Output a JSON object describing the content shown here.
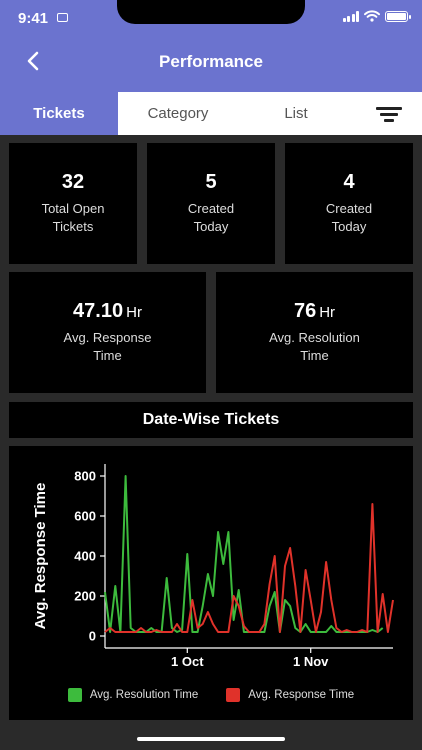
{
  "status_bar": {
    "time": "9:41"
  },
  "header": {
    "title": "Performance"
  },
  "tabs": [
    {
      "label": "Tickets",
      "active": true
    },
    {
      "label": "Category",
      "active": false
    },
    {
      "label": "List",
      "active": false
    }
  ],
  "stats_row1": [
    {
      "value": "32",
      "label_line1": "Total Open",
      "label_line2": "Tickets"
    },
    {
      "value": "5",
      "label_line1": "Created",
      "label_line2": "Today"
    },
    {
      "value": "4",
      "label_line1": "Created",
      "label_line2": "Today"
    }
  ],
  "stats_row2": [
    {
      "value": "47.10",
      "unit": "Hr",
      "label_line1": "Avg. Response",
      "label_line2": "Time"
    },
    {
      "value": "76",
      "unit": "Hr",
      "label_line1": "Avg. Resolution",
      "label_line2": "Time"
    }
  ],
  "section": {
    "title": "Date-Wise Tickets"
  },
  "colors": {
    "accent": "#6b73cf",
    "green": "#3dbb3d",
    "red": "#e0322a"
  },
  "chart_data": {
    "type": "line",
    "ylabel": "Avg. Response Time",
    "xlabel": "",
    "ylim": [
      -60,
      860
    ],
    "yticks": [
      0,
      200,
      400,
      600,
      800
    ],
    "xlim": [
      0,
      56
    ],
    "xticks": [
      {
        "x": 16,
        "label": "1 Oct"
      },
      {
        "x": 40,
        "label": "1 Nov"
      }
    ],
    "series": [
      {
        "name": "Avg. Resolution Time",
        "color": "#3dbb3d",
        "points": [
          [
            0,
            220
          ],
          [
            1,
            20
          ],
          [
            2,
            250
          ],
          [
            3,
            20
          ],
          [
            4,
            800
          ],
          [
            5,
            40
          ],
          [
            6,
            20
          ],
          [
            7,
            20
          ],
          [
            8,
            20
          ],
          [
            9,
            40
          ],
          [
            10,
            20
          ],
          [
            11,
            20
          ],
          [
            12,
            290
          ],
          [
            13,
            40
          ],
          [
            14,
            20
          ],
          [
            15,
            30
          ],
          [
            16,
            410
          ],
          [
            17,
            20
          ],
          [
            18,
            20
          ],
          [
            19,
            150
          ],
          [
            20,
            310
          ],
          [
            21,
            200
          ],
          [
            22,
            520
          ],
          [
            23,
            360
          ],
          [
            24,
            520
          ],
          [
            25,
            80
          ],
          [
            26,
            230
          ],
          [
            27,
            20
          ],
          [
            28,
            20
          ],
          [
            29,
            20
          ],
          [
            30,
            20
          ],
          [
            31,
            20
          ],
          [
            32,
            150
          ],
          [
            33,
            220
          ],
          [
            34,
            20
          ],
          [
            35,
            180
          ],
          [
            36,
            150
          ],
          [
            37,
            40
          ],
          [
            38,
            20
          ],
          [
            39,
            60
          ],
          [
            40,
            20
          ],
          [
            41,
            20
          ],
          [
            42,
            20
          ],
          [
            43,
            20
          ],
          [
            44,
            50
          ],
          [
            45,
            20
          ],
          [
            46,
            20
          ],
          [
            47,
            20
          ],
          [
            48,
            20
          ],
          [
            49,
            20
          ],
          [
            50,
            20
          ],
          [
            51,
            20
          ],
          [
            52,
            30
          ],
          [
            53,
            20
          ],
          [
            54,
            40
          ]
        ]
      },
      {
        "name": "Avg. Response Time",
        "color": "#e0322a",
        "points": [
          [
            0,
            20
          ],
          [
            1,
            40
          ],
          [
            2,
            20
          ],
          [
            3,
            20
          ],
          [
            4,
            20
          ],
          [
            5,
            20
          ],
          [
            6,
            20
          ],
          [
            7,
            40
          ],
          [
            8,
            20
          ],
          [
            9,
            20
          ],
          [
            10,
            30
          ],
          [
            11,
            20
          ],
          [
            12,
            20
          ],
          [
            13,
            20
          ],
          [
            14,
            60
          ],
          [
            15,
            20
          ],
          [
            16,
            20
          ],
          [
            17,
            180
          ],
          [
            18,
            40
          ],
          [
            19,
            60
          ],
          [
            20,
            120
          ],
          [
            21,
            60
          ],
          [
            22,
            20
          ],
          [
            23,
            20
          ],
          [
            24,
            20
          ],
          [
            25,
            200
          ],
          [
            26,
            150
          ],
          [
            27,
            50
          ],
          [
            28,
            20
          ],
          [
            29,
            20
          ],
          [
            30,
            20
          ],
          [
            31,
            60
          ],
          [
            32,
            260
          ],
          [
            33,
            400
          ],
          [
            34,
            20
          ],
          [
            35,
            350
          ],
          [
            36,
            440
          ],
          [
            37,
            250
          ],
          [
            38,
            20
          ],
          [
            39,
            330
          ],
          [
            40,
            180
          ],
          [
            41,
            20
          ],
          [
            42,
            120
          ],
          [
            43,
            370
          ],
          [
            44,
            180
          ],
          [
            45,
            40
          ],
          [
            46,
            20
          ],
          [
            47,
            30
          ],
          [
            48,
            20
          ],
          [
            49,
            20
          ],
          [
            50,
            30
          ],
          [
            51,
            20
          ],
          [
            52,
            660
          ],
          [
            53,
            20
          ],
          [
            54,
            210
          ],
          [
            55,
            20
          ],
          [
            56,
            180
          ]
        ]
      }
    ],
    "legend": "bottom"
  }
}
